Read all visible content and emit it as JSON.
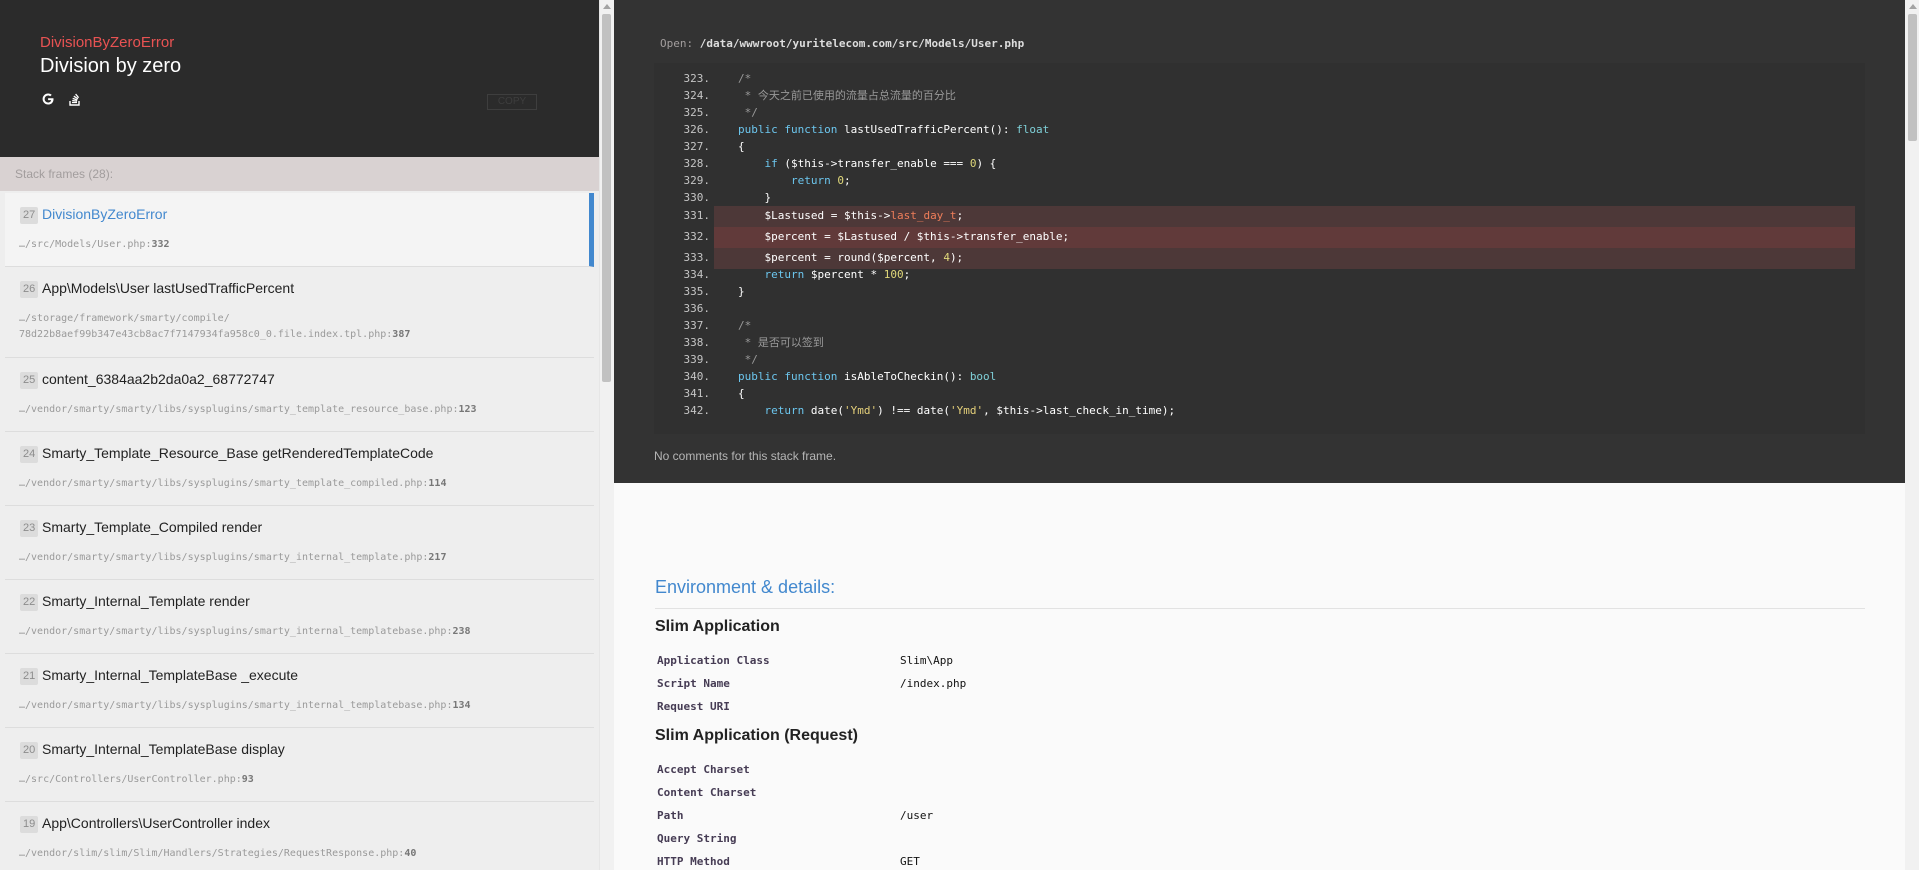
{
  "header": {
    "exception_class": "DivisionByZeroError",
    "exception_message": "Division by zero",
    "search_icons": [
      "google-icon",
      "stackoverflow-icon"
    ],
    "copy_label": "COPY"
  },
  "stack": {
    "count_label": "Stack frames (28):",
    "frames": [
      {
        "index": "27",
        "title": "DivisionByZeroError",
        "file": "…/src/Models/User.php",
        "line": "332",
        "active": true
      },
      {
        "index": "26",
        "title": "App\\Models\\User lastUsedTrafficPercent",
        "file": "…/storage/framework/smarty/compile/ 78d22b8aef99b347e43cb8ac7f7147934fa958c0_0.file.index.tpl.php",
        "line": "387"
      },
      {
        "index": "25",
        "title": "content_6384aa2b2da0a2_68772747",
        "file": "…/vendor/smarty/smarty/libs/sysplugins/smarty_template_resource_base.php",
        "line": "123"
      },
      {
        "index": "24",
        "title": "Smarty_Template_Resource_Base getRenderedTemplateCode",
        "file": "…/vendor/smarty/smarty/libs/sysplugins/smarty_template_compiled.php",
        "line": "114"
      },
      {
        "index": "23",
        "title": "Smarty_Template_Compiled render",
        "file": "…/vendor/smarty/smarty/libs/sysplugins/smarty_internal_template.php",
        "line": "217"
      },
      {
        "index": "22",
        "title": "Smarty_Internal_Template render",
        "file": "…/vendor/smarty/smarty/libs/sysplugins/smarty_internal_templatebase.php",
        "line": "238"
      },
      {
        "index": "21",
        "title": "Smarty_Internal_TemplateBase _execute",
        "file": "…/vendor/smarty/smarty/libs/sysplugins/smarty_internal_templatebase.php",
        "line": "134"
      },
      {
        "index": "20",
        "title": "Smarty_Internal_TemplateBase display",
        "file": "…/src/Controllers/UserController.php",
        "line": "93"
      },
      {
        "index": "19",
        "title": "App\\Controllers\\UserController index",
        "file": "…/vendor/slim/slim/Slim/Handlers/Strategies/RequestResponse.php",
        "line": "40"
      }
    ]
  },
  "code": {
    "open_label": "Open:",
    "path": "/data/wwwroot/yuritelecom.com/src/Models/User.php",
    "line_numbers": [
      "323.",
      "324.",
      "325.",
      "326.",
      "327.",
      "328.",
      "329.",
      "330.",
      "331.",
      "332.",
      "333.",
      "334.",
      "335.",
      "336.",
      "337.",
      "338.",
      "339.",
      "340.",
      "341.",
      "342."
    ],
    "lines": [
      "/*",
      " * 今天之前已使用的流量占总流量的百分比",
      " */",
      "public function lastUsedTrafficPercent(): float",
      "{",
      "    if ($this->transfer_enable === 0) {",
      "        return 0;",
      "    }",
      "    $Lastused = $this->last_day_t;",
      "    $percent = $Lastused / $this->transfer_enable;",
      "    $percent = round($percent, 4);",
      "    return $percent * 100;",
      "}",
      "",
      "/*",
      " * 是否可以签到",
      " */",
      "public function isAbleToCheckin(): bool",
      "{",
      "    return date('Ymd') !== date('Ymd', $this->last_check_in_time);"
    ],
    "comments_text": "No comments for this stack frame."
  },
  "env": {
    "title": "Environment & details:",
    "sections": [
      {
        "name": "Slim Application",
        "rows": [
          {
            "key": "Application Class",
            "value": "Slim\\App"
          },
          {
            "key": "Script Name",
            "value": "/index.php"
          },
          {
            "key": "Request URI",
            "value": ""
          }
        ]
      },
      {
        "name": "Slim Application (Request)",
        "rows": [
          {
            "key": "Accept Charset",
            "value": ""
          },
          {
            "key": "Content Charset",
            "value": ""
          },
          {
            "key": "Path",
            "value": "/user"
          },
          {
            "key": "Query String",
            "value": ""
          },
          {
            "key": "HTTP Method",
            "value": "GET"
          }
        ]
      }
    ]
  }
}
